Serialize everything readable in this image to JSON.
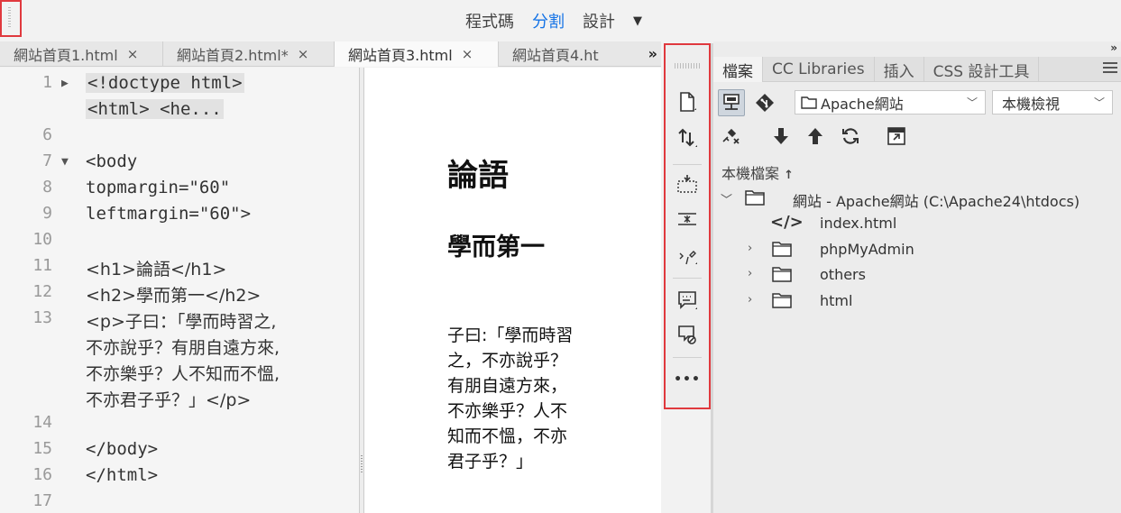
{
  "view_modes": {
    "code": "程式碼",
    "split": "分割",
    "design": "設計"
  },
  "tabs": [
    {
      "label": "網站首頁1.html",
      "close": "×"
    },
    {
      "label": "網站首頁2.html*",
      "close": "×"
    },
    {
      "label": "網站首頁3.html",
      "close": "×"
    },
    {
      "label": "網站首頁4.ht",
      "close": ""
    }
  ],
  "tabs_more": "»",
  "code_lines": [
    {
      "n": "1",
      "fold": "▶",
      "text": "<!doctype html>"
    },
    {
      "n": "",
      "fold": "",
      "text": "<html> <he..."
    },
    {
      "n": "6",
      "fold": "",
      "text": ""
    },
    {
      "n": "7",
      "fold": "▼",
      "text": "<body"
    },
    {
      "n": "8",
      "fold": "",
      "text": "topmargin=\"60\""
    },
    {
      "n": "9",
      "fold": "",
      "text": "leftmargin=\"60\">"
    },
    {
      "n": "10",
      "fold": "",
      "text": ""
    },
    {
      "n": "11",
      "fold": "",
      "text": "<h1>論語</h1>"
    },
    {
      "n": "12",
      "fold": "",
      "text": "<h2>學而第一</h2>"
    },
    {
      "n": "13",
      "fold": "",
      "text": "<p>子曰：「學而時習之,"
    },
    {
      "n": "",
      "fold": "",
      "text": "不亦說乎？有朋自遠方來,"
    },
    {
      "n": "",
      "fold": "",
      "text": "不亦樂乎？人不知而不慍,"
    },
    {
      "n": "",
      "fold": "",
      "text": "不亦君子乎？」</p>"
    },
    {
      "n": "14",
      "fold": "",
      "text": ""
    },
    {
      "n": "15",
      "fold": "",
      "text": "</body>"
    },
    {
      "n": "16",
      "fold": "",
      "text": "</html>"
    },
    {
      "n": "17",
      "fold": "",
      "text": ""
    }
  ],
  "preview": {
    "h1": "論語",
    "h2": "學而第一",
    "p": "子曰:「學而時習之，不亦說乎？有朋自遠方來，不亦樂乎？人不知而不慍，不亦君子乎？」"
  },
  "panel": {
    "tabs": [
      "檔案",
      "CC Libraries",
      "插入",
      "CSS 設計工具"
    ],
    "site_select": "Apache網站",
    "view_select": "本機檢視",
    "local_files_label": "本機檔案",
    "root": "網站 - Apache網站 (C:\\Apache24\\htdocs)",
    "items": [
      {
        "name": "index.html",
        "type": "file"
      },
      {
        "name": "phpMyAdmin",
        "type": "folder"
      },
      {
        "name": "others",
        "type": "folder"
      },
      {
        "name": "html",
        "type": "folder"
      }
    ]
  },
  "vtool_more": "•••",
  "colors": {
    "accent": "#1473e6",
    "highlight_border": "#e0393e"
  }
}
